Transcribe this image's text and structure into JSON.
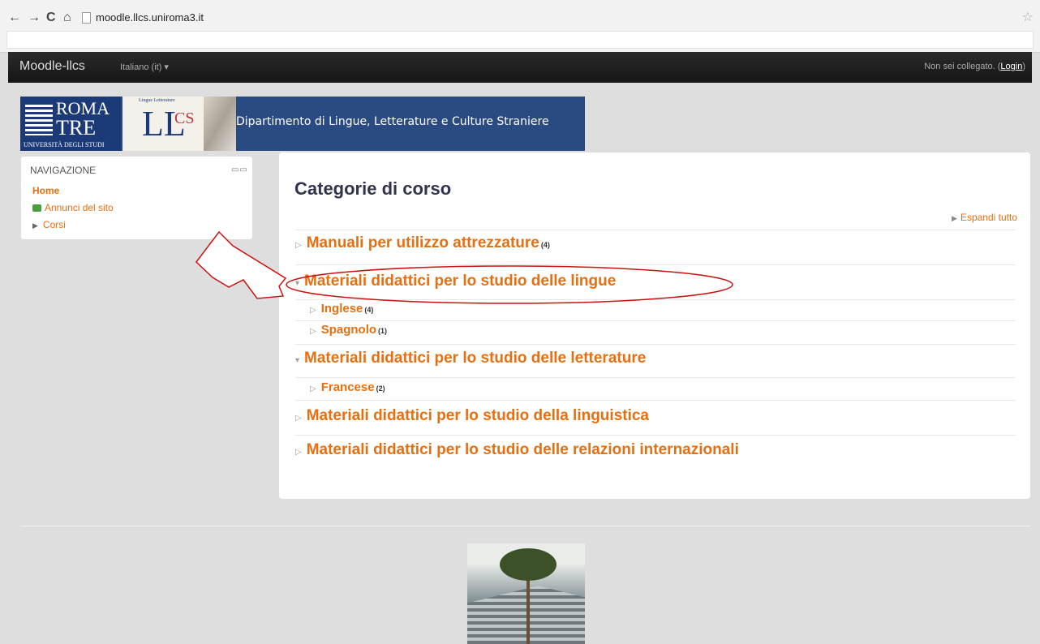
{
  "browser": {
    "url": "moodle.llcs.uniroma3.it",
    "back": "←",
    "forward": "→",
    "reload": "C",
    "home": "⌂",
    "star": "☆"
  },
  "navbar": {
    "brand": "Moodle-llcs",
    "language": "Italiano (it) ▾",
    "login_prefix": "Non sei collegato. (",
    "login_link": "Login",
    "login_suffix": ")"
  },
  "banner": {
    "roma": "ROMA",
    "tre": "TRE",
    "univ": "UNIVERSITÀ DEGLI STUDI",
    "llcs_small": "Lingue Letterature",
    "title": "Dipartimento di Lingue, Letterature e Culture Straniere"
  },
  "navigation": {
    "heading": "NAVIGAZIONE",
    "controls": "▭▭",
    "home": "Home",
    "annunci": "Annunci del sito",
    "corsi": "Corsi"
  },
  "main": {
    "title": "Categorie di corso",
    "expand_all": "Espandi tutto",
    "categories": [
      {
        "label": "Manuali per utilizzo attrezzature",
        "count": "(4)",
        "arrow": "▷"
      },
      {
        "label": "Materiali didattici per lo studio delle lingue",
        "count": "",
        "arrow": "▾"
      },
      {
        "label": "Inglese",
        "count": "(4)",
        "arrow": "▷"
      },
      {
        "label": "Spagnolo",
        "count": "(1)",
        "arrow": "▷"
      },
      {
        "label": "Materiali didattici per lo studio delle letterature",
        "count": "",
        "arrow": "▾"
      },
      {
        "label": "Francese",
        "count": "(2)",
        "arrow": "▷"
      },
      {
        "label": "Materiali didattici per lo studio della linguistica",
        "count": "",
        "arrow": "▷"
      },
      {
        "label": "Materiali didattici per lo studio delle relazioni internazionali",
        "count": "",
        "arrow": "▷"
      }
    ]
  },
  "colors": {
    "link": "#e86f10",
    "annotation": "#cc1111"
  }
}
